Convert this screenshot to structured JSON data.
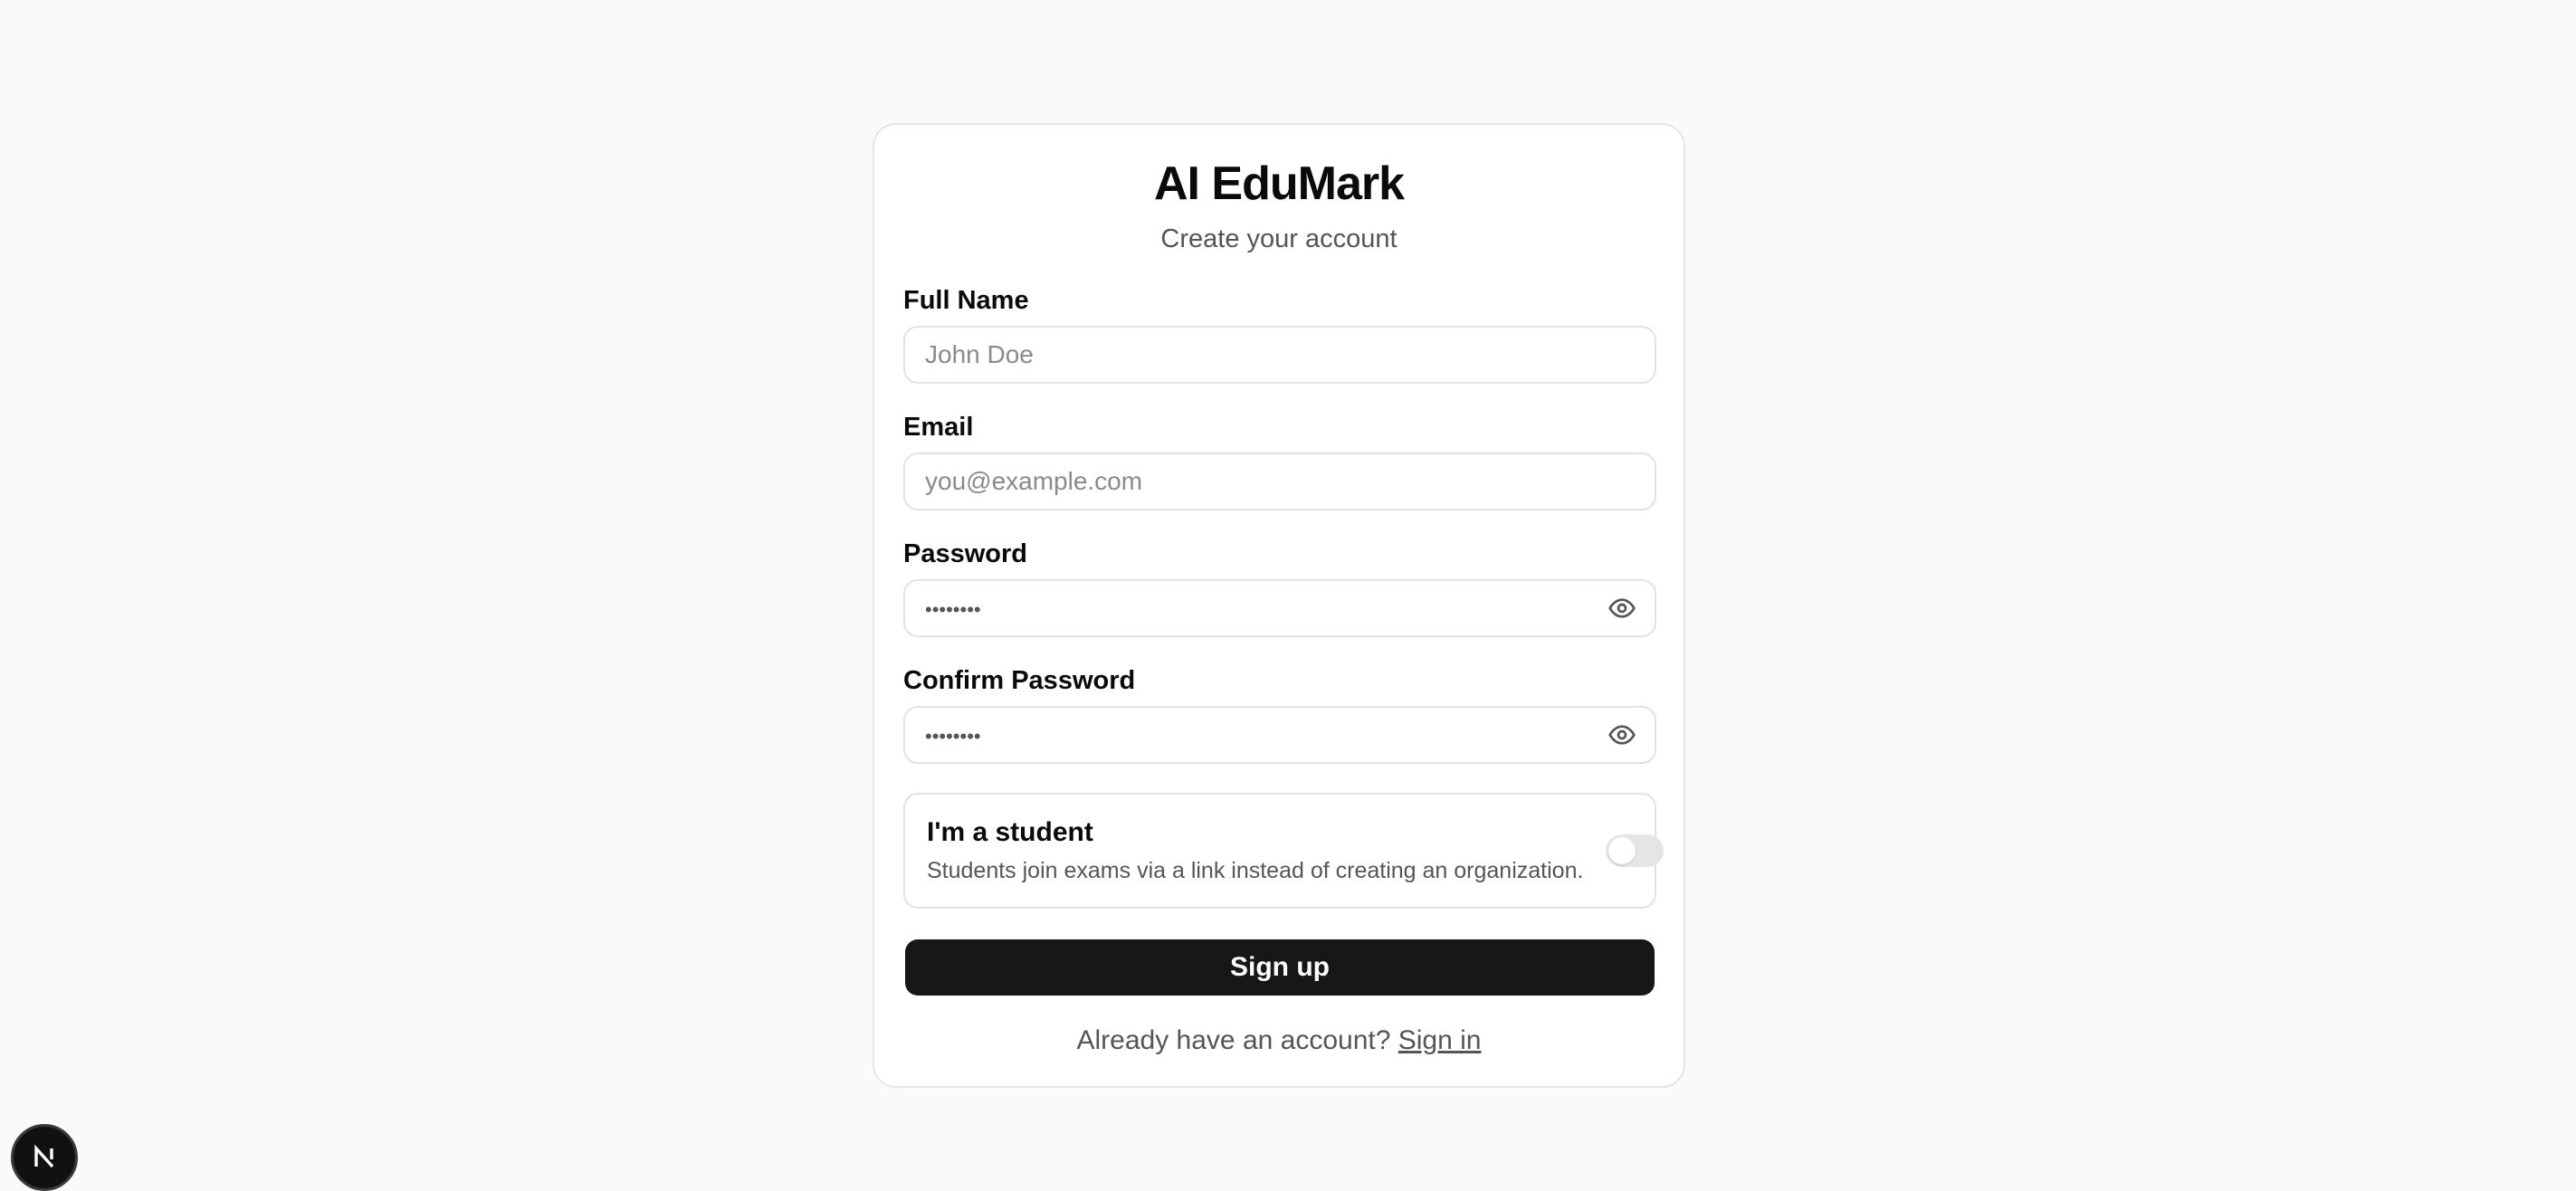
{
  "app": {
    "title": "AI EduMark",
    "subtitle": "Create your account"
  },
  "form": {
    "full_name": {
      "label": "Full Name",
      "placeholder": "John Doe",
      "value": ""
    },
    "email": {
      "label": "Email",
      "placeholder": "you@example.com",
      "value": ""
    },
    "password": {
      "label": "Password",
      "placeholder": "••••••••",
      "value": "",
      "toggle_icon": "eye-icon"
    },
    "confirm_password": {
      "label": "Confirm Password",
      "placeholder": "••••••••",
      "value": "",
      "toggle_icon": "eye-icon"
    },
    "student": {
      "title": "I'm a student",
      "description": "Students join exams via a link instead of creating an organization.",
      "enabled": false
    },
    "submit_label": "Sign up"
  },
  "footer": {
    "prompt": "Already have an account?",
    "link_label": "Sign in"
  },
  "dev_badge": {
    "glyph": "N",
    "icon": "nextjs-logo-icon"
  },
  "colors": {
    "background": "#fafafa",
    "card": "#ffffff",
    "primary_button": "#171717",
    "muted_text": "#555555",
    "border": "#e2e2e2"
  }
}
